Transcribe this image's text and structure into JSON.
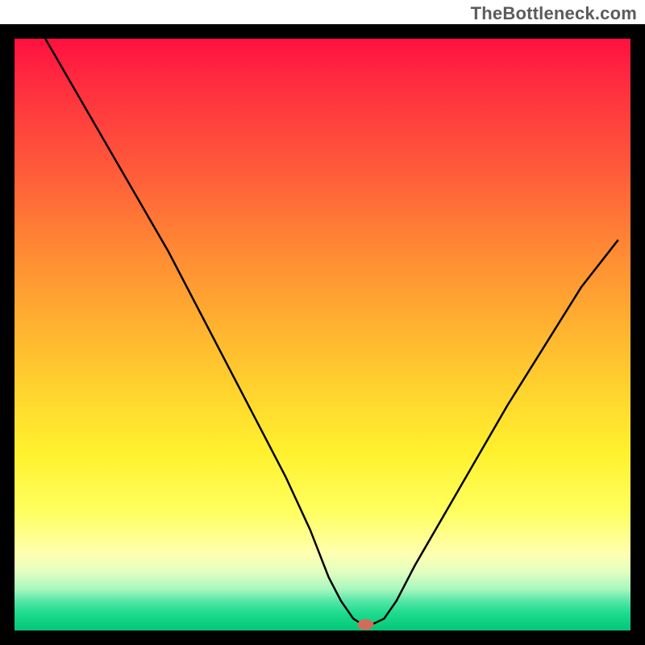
{
  "watermark": "TheBottleneck.com",
  "chart_data": {
    "type": "line",
    "title": "",
    "xlabel": "",
    "ylabel": "",
    "xlim": [
      0,
      100
    ],
    "ylim": [
      0,
      100
    ],
    "series": [
      {
        "name": "curve",
        "x": [
          5,
          10,
          15,
          20,
          25,
          30,
          33,
          36,
          40,
          44,
          48,
          51,
          53,
          55,
          56.5,
          58,
          60,
          62,
          65,
          70,
          75,
          80,
          86,
          92,
          98
        ],
        "y": [
          100,
          91,
          82,
          73,
          64,
          54,
          48,
          42,
          34,
          26,
          17,
          9,
          5,
          2,
          1,
          1,
          2,
          5,
          11,
          20,
          29,
          38,
          48,
          58,
          66
        ]
      }
    ],
    "annotations": [
      {
        "name": "minimum-marker",
        "x": 57,
        "y": 1
      }
    ],
    "background_gradient_stops": [
      {
        "pos": 0,
        "color": "#ff1040"
      },
      {
        "pos": 22,
        "color": "#ff5a3a"
      },
      {
        "pos": 48,
        "color": "#ffb030"
      },
      {
        "pos": 70,
        "color": "#fff12e"
      },
      {
        "pos": 87,
        "color": "#ffffb0"
      },
      {
        "pos": 95,
        "color": "#57e6a8"
      },
      {
        "pos": 100,
        "color": "#07c676"
      }
    ]
  }
}
